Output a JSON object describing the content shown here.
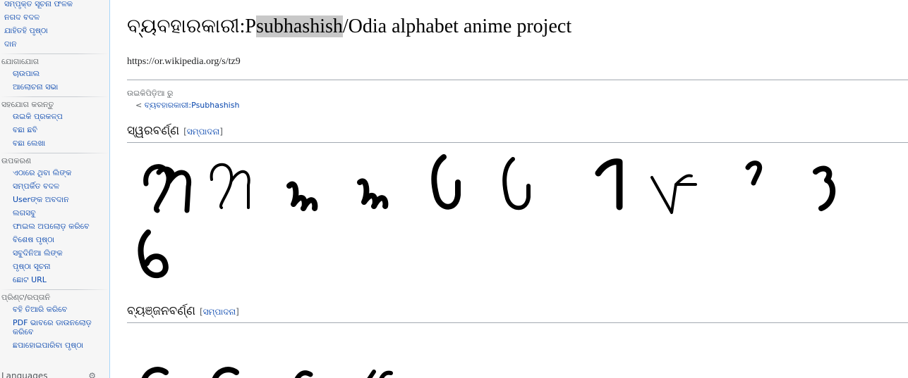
{
  "sidebar": {
    "top_items": [
      "ସମ୍ପୃକ୍ତ ସୂଚନା ଫଳକ",
      "ନଗଦ ବଦଳ",
      "ଯାହିତହି ପୃଷ୍ଠା",
      "ଦାନ"
    ],
    "sections": [
      {
        "heading": "ଯୋଗାଯୋଗ",
        "items": [
          "ଚାଉପାଲ",
          "ଆଲୋଚନା ସଭା"
        ]
      },
      {
        "heading": "ସହଯୋଗ କରନ୍ତୁ",
        "items": [
          "ଉଇକି ପ୍ରକଳ୍ପ",
          "ବଛା ଛବି",
          "ବଛା ଲେଖା"
        ]
      },
      {
        "heading": "ଉପକରଣ",
        "items": [
          "ଏଠାରେ ଥିବା ଲିଙ୍କ",
          "ସମ୍ପର୍କିତ ବଦଳ",
          "Userଙ୍କ ଅବଦାନ",
          "ଲଗସବୁ",
          "ଫାଇଲ ଅପଲୋଡ଼ କରିବେ",
          "ବିଶେଷ ପୃଷ୍ଠା",
          "ସବୁଦିନିଆ ଲିଙ୍କ",
          "ପୃଷ୍ଠା ସୂଚନା",
          "ଛୋଟ URL"
        ]
      },
      {
        "heading": "ପ୍ରିଣ୍ଟ/ରପ୍ତାନି",
        "items": [
          "ବହି ତିଆରି କରିବେ",
          "PDF ଭାବରେ ଡାଉନଲୋଡ଼ କରିବେ",
          "ଛପାହୋଇପାରିବା ପୃଷ୍ଠା"
        ]
      }
    ],
    "languages_label": "Languages"
  },
  "page": {
    "title_prefix": "ବ୍ୟବହାରକାରୀ:P",
    "title_highlight": "subhashish",
    "title_suffix": "/Odia alphabet anime project",
    "short_url": "https://or.wikipedia.org/s/tz9",
    "tagline": "ଉଇକିପିଡ଼ିଆ ରୁ",
    "subpages_prefix": "< ",
    "subpages_link": "ବ୍ୟବହାରକାରୀ:Psubhashish"
  },
  "sections": [
    {
      "title": "ସ୍ୱରବର୍ଣ୍ଣ",
      "edit": "ସମ୍ପାଦନା"
    },
    {
      "title": "ବ୍ୟଞ୍ଜନବର୍ଣ୍ଣ",
      "edit": "ସମ୍ପାଦନା"
    }
  ]
}
